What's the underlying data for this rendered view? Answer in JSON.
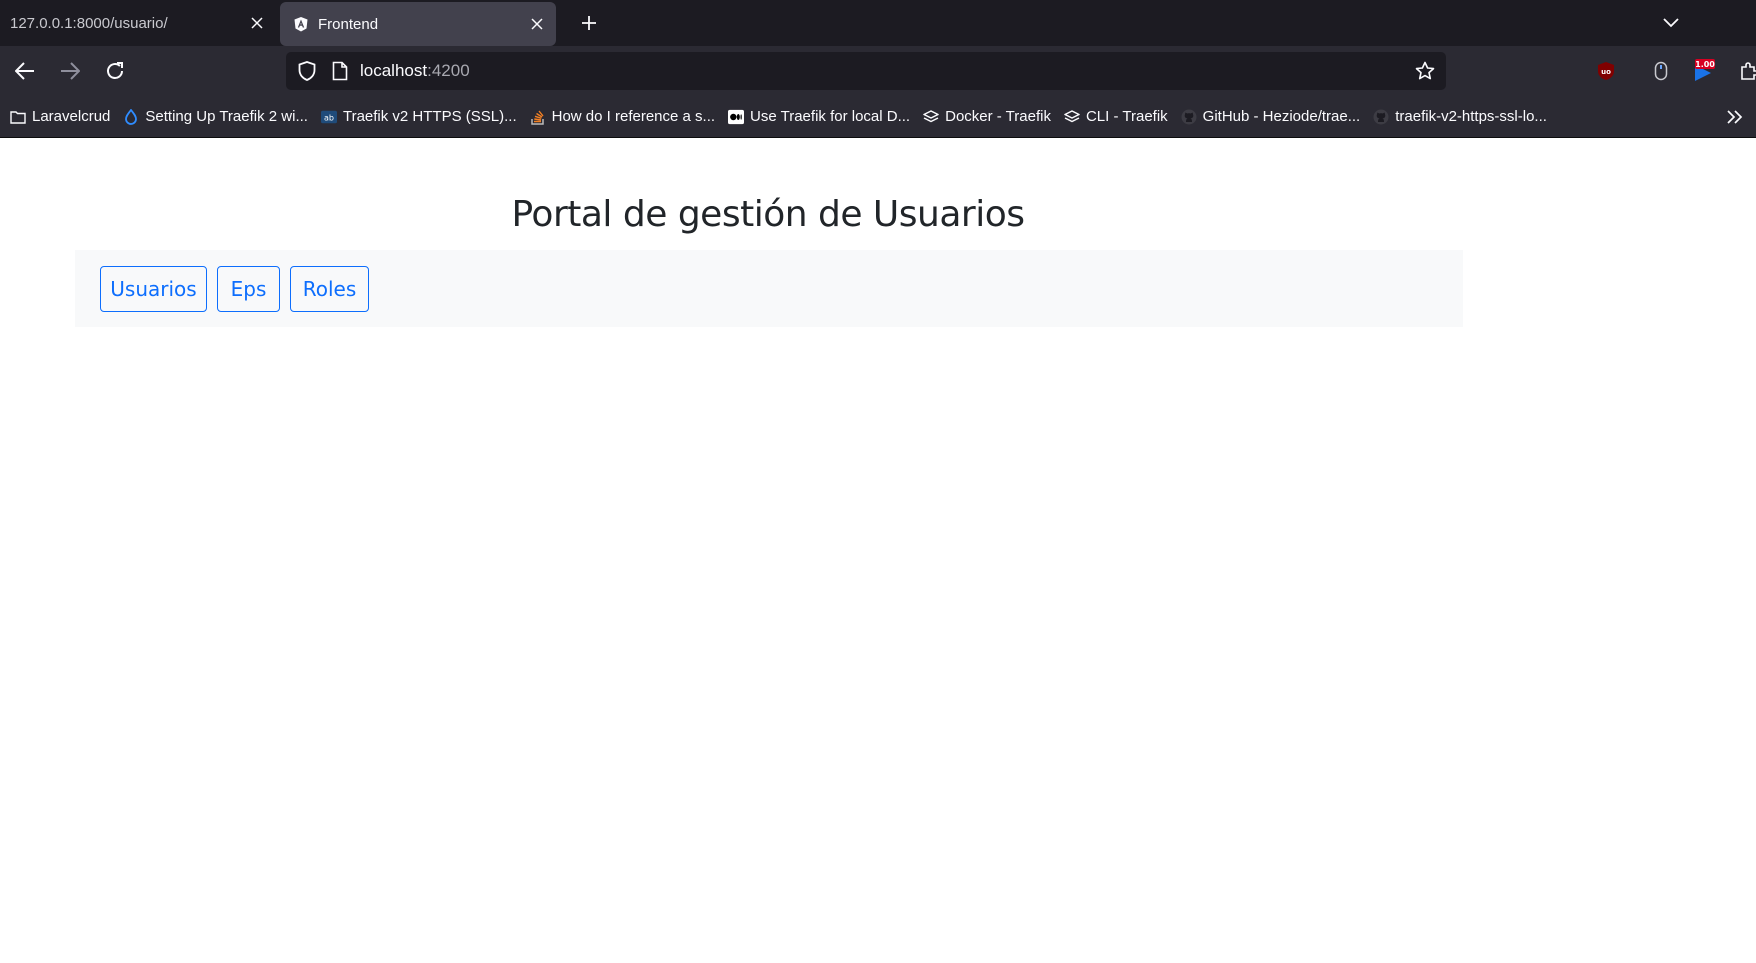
{
  "browser": {
    "tabs": [
      {
        "title": "127.0.0.1:8000/usuario/",
        "active": false
      },
      {
        "title": "Frontend",
        "active": true
      }
    ],
    "url": {
      "host": "localhost",
      "port": ":4200"
    },
    "extensions": {
      "badge": "1.00"
    },
    "bookmarks": [
      {
        "label": "Laravelcrud",
        "icon": "folder-icon"
      },
      {
        "label": "Setting Up Traefik 2 wi...",
        "icon": "digitalocean-icon"
      },
      {
        "label": "Traefik v2 HTTPS (SSL)...",
        "icon": "site-icon"
      },
      {
        "label": "How do I reference a s...",
        "icon": "stackoverflow-icon"
      },
      {
        "label": "Use Traefik for local D...",
        "icon": "medium-icon"
      },
      {
        "label": "Docker - Traefik",
        "icon": "traefik-icon"
      },
      {
        "label": "CLI - Traefik",
        "icon": "traefik-icon"
      },
      {
        "label": "GitHub - Heziode/trae...",
        "icon": "github-icon"
      },
      {
        "label": "traefik-v2-https-ssl-lo...",
        "icon": "github-icon"
      }
    ]
  },
  "page": {
    "title": "Portal de gestión de Usuarios",
    "nav_buttons": [
      "Usuarios",
      "Eps",
      "Roles"
    ]
  },
  "colors": {
    "primary": "#0d6efd",
    "panel_bg": "#f8f9fa",
    "browser_dark": "#1c1b22",
    "toolbar": "#2b2a33"
  }
}
